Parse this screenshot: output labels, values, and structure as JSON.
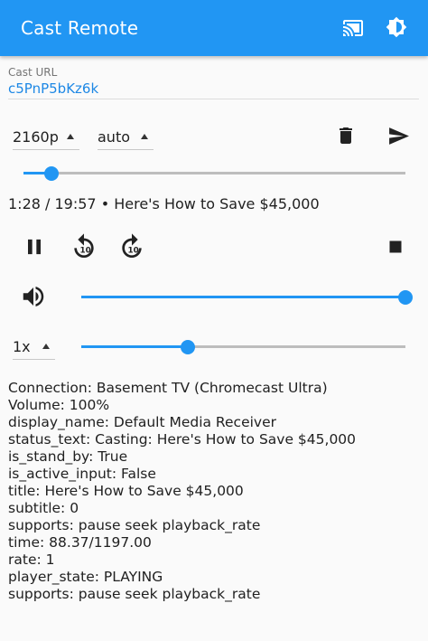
{
  "app": {
    "title": "Cast Remote"
  },
  "icons": {
    "cast": "cast-connected-icon",
    "brightness": "brightness-icon",
    "delete": "trash-icon",
    "send": "send-icon",
    "pause": "pause-icon",
    "rewind": "replay-10-icon",
    "forward": "forward-10-icon",
    "stop": "stop-icon",
    "volume": "volume-up-icon"
  },
  "url": {
    "label": "Cast URL",
    "value": "c5PnP5bKz6k"
  },
  "controls": {
    "quality": "2160p",
    "subtitle_mode": "auto",
    "speed": "1x"
  },
  "progress": {
    "fraction": 0.074
  },
  "volume": {
    "fraction": 1.0
  },
  "speed_slider": {
    "fraction": 0.33
  },
  "now_playing": "1:28 / 19:57  •  Here's How to Save $45,000",
  "info_lines": [
    "Connection: Basement TV (Chromecast Ultra)",
    "Volume: 100%",
    "display_name: Default Media Receiver",
    "status_text: Casting: Here's How to Save $45,000",
    "is_stand_by: True",
    "is_active_input: False",
    "title: Here's How to Save $45,000",
    "subtitle: 0",
    "supports: pause seek playback_rate",
    "time: 88.37/1197.00",
    "rate: 1",
    "player_state: PLAYING",
    "supports: pause seek playback_rate"
  ],
  "colors": {
    "primary": "#2196f3",
    "link": "#1e88e5"
  }
}
